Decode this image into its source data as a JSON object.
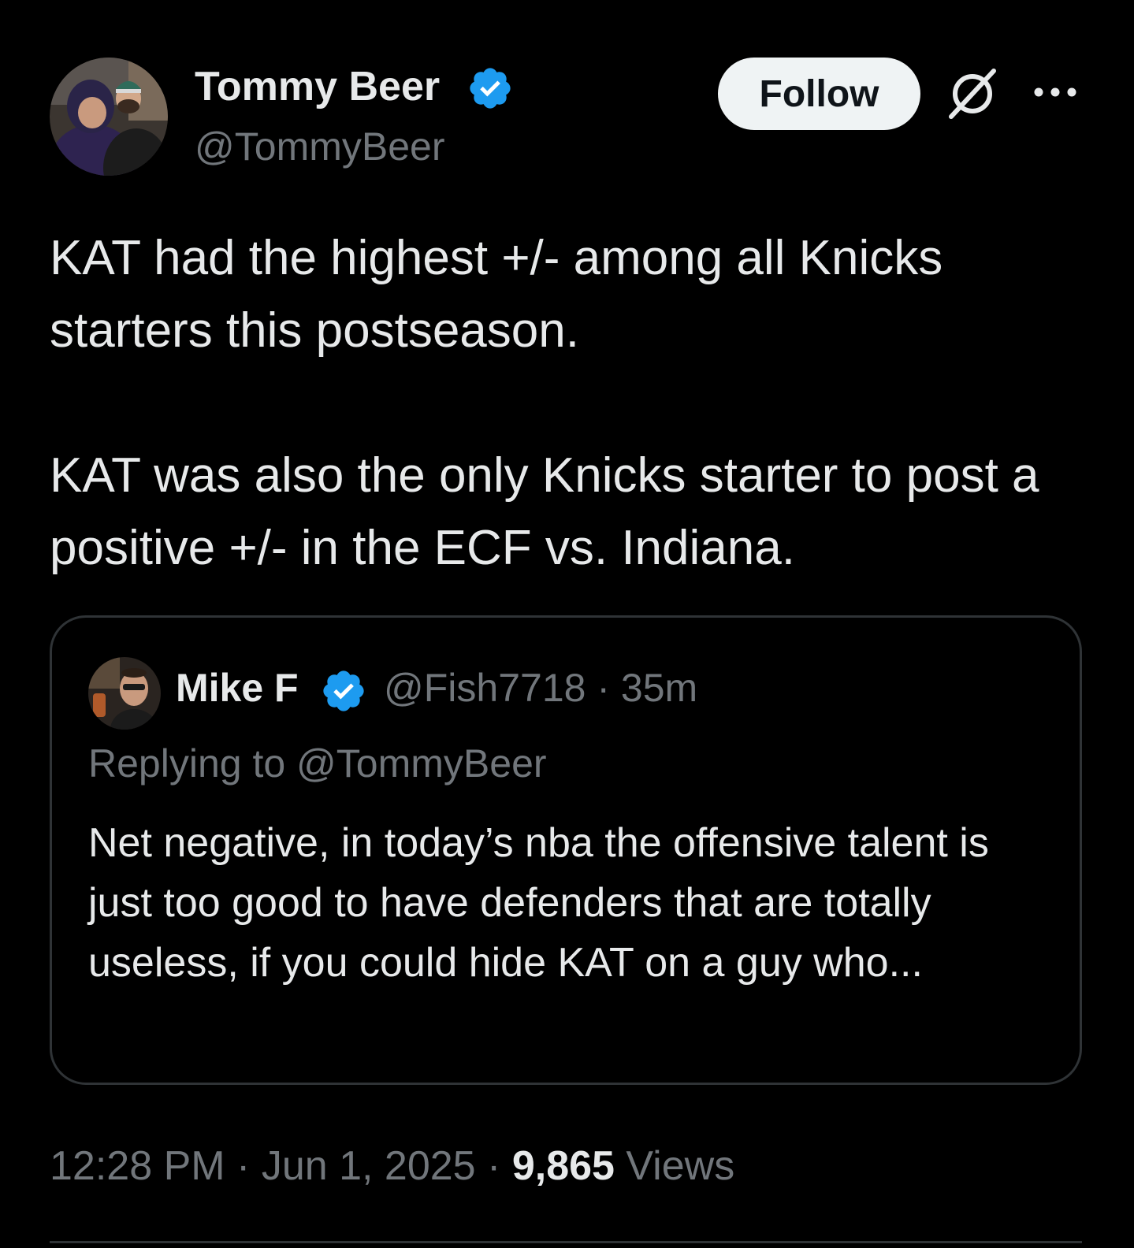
{
  "author": {
    "display_name": "Tommy Beer",
    "handle": "@TommyBeer",
    "verified": true
  },
  "actions": {
    "follow_label": "Follow",
    "grok_icon": "grok-icon",
    "more_icon": "more-icon"
  },
  "tweet": {
    "paragraphs": [
      "KAT had the highest +/- among all Knicks starters this postseason.",
      "KAT was also the only Knicks starter to post a positive +/- in the ECF vs. Indiana."
    ]
  },
  "quote": {
    "display_name": "Mike F",
    "handle": "@Fish7718",
    "separator": "·",
    "time": "35m",
    "replying_prefix": "Replying to ",
    "replying_to": "@TommyBeer",
    "text": "Net negative, in today’s nba the offensive talent is just too good to have defenders that are totally useless, if you could hide KAT on a guy who..."
  },
  "footer": {
    "time": "12:28 PM",
    "separator": "·",
    "date": "Jun 1, 2025",
    "views_count": "9,865",
    "views_label": "Views"
  },
  "colors": {
    "background": "#000000",
    "text_primary": "#e7e9ea",
    "text_secondary": "#71767b",
    "verified_blue": "#1d9bf0",
    "border": "#2f3336",
    "follow_bg": "#eff3f4"
  }
}
